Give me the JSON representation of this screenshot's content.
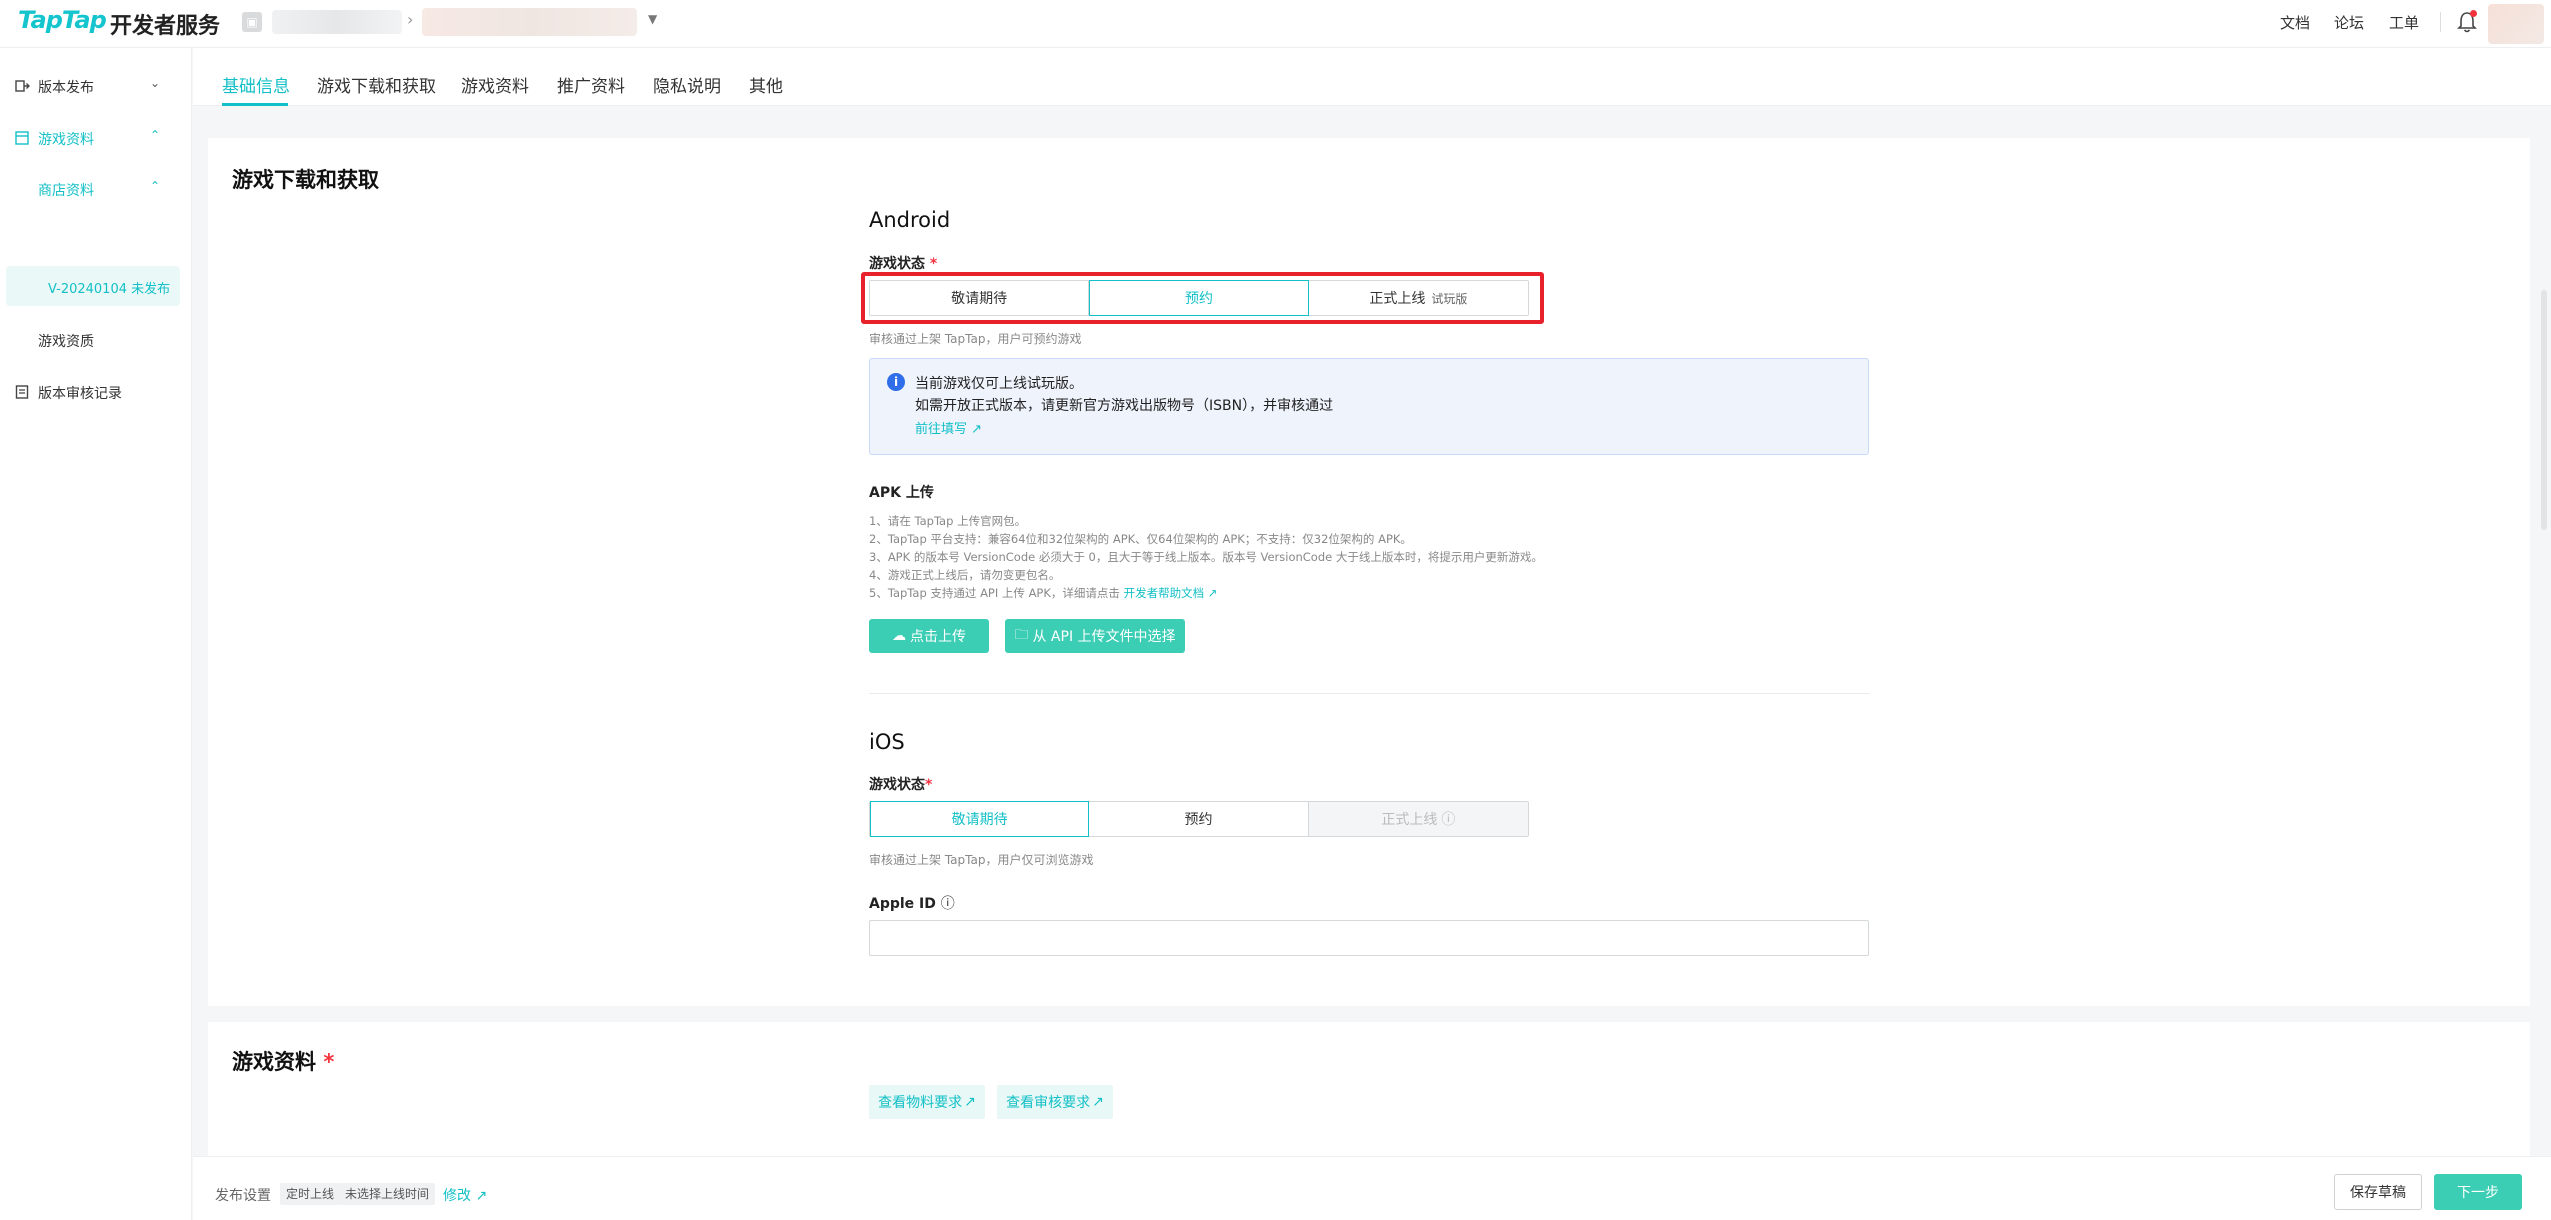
{
  "brand": {
    "logo": "TapTap",
    "subtitle": "开发者服务"
  },
  "header": {
    "links": [
      "文档",
      "论坛",
      "工单"
    ],
    "colors": {
      "accent": "#14c0c7",
      "badge": "#f5333f"
    }
  },
  "sidebar": {
    "items": [
      {
        "label": "版本发布",
        "icon": "publish-icon"
      },
      {
        "label": "游戏资料",
        "icon": "store-icon"
      },
      {
        "label": "商店资料"
      },
      {
        "label": "V-20240104 未发布"
      },
      {
        "label": "游戏资质"
      },
      {
        "label": "版本审核记录",
        "icon": "record-icon"
      }
    ]
  },
  "tabs": [
    "基础信息",
    "游戏下载和获取",
    "游戏资料",
    "推广资料",
    "隐私说明",
    "其他"
  ],
  "download": {
    "title": "游戏下载和获取",
    "android": {
      "title": "Android",
      "status_label": "游戏状态",
      "options": [
        "敬请期待",
        "预约",
        "正式上线"
      ],
      "option_sub": "试玩版",
      "selected": "预约",
      "help": "审核通过上架 TapTap，用户可预约游戏",
      "notice": {
        "line1": "当前游戏仅可上线试玩版。",
        "line2": "如需开放正式版本，请更新官方游戏出版物号（ISBN），并审核通过",
        "link": "前往填写"
      },
      "apk": {
        "label": "APK 上传",
        "lines": [
          "1、请在 TapTap 上传官网包。",
          "2、TapTap 平台支持：兼容64位和32位架构的 APK、仅64位架构的 APK；不支持：仅32位架构的 APK。",
          "3、APK 的版本号 VersionCode 必须大于 0，且大于等于线上版本。版本号 VersionCode 大于线上版本时，将提示用户更新游戏。",
          "4、游戏正式上线后，请勿变更包名。",
          "5、TapTap 支持通过 API 上传 APK，详细请点击"
        ],
        "doc_link": "开发者帮助文档",
        "upload_btn": "点击上传",
        "api_btn": "从 API 上传文件中选择"
      }
    },
    "ios": {
      "title": "iOS",
      "status_label": "游戏状态",
      "options": [
        "敬请期待",
        "预约",
        "正式上线"
      ],
      "selected": "敬请期待",
      "help": "审核通过上架 TapTap，用户仅可浏览游戏",
      "apple_id_label": "Apple ID",
      "apple_id_value": ""
    }
  },
  "materials": {
    "title": "游戏资料",
    "btn1": "查看物料要求",
    "btn2": "查看审核要求"
  },
  "footer": {
    "label": "发布设置",
    "tag1": "定时上线",
    "tag2": "未选择上线时间",
    "edit": "修改",
    "save": "保存草稿",
    "next": "下一步"
  }
}
